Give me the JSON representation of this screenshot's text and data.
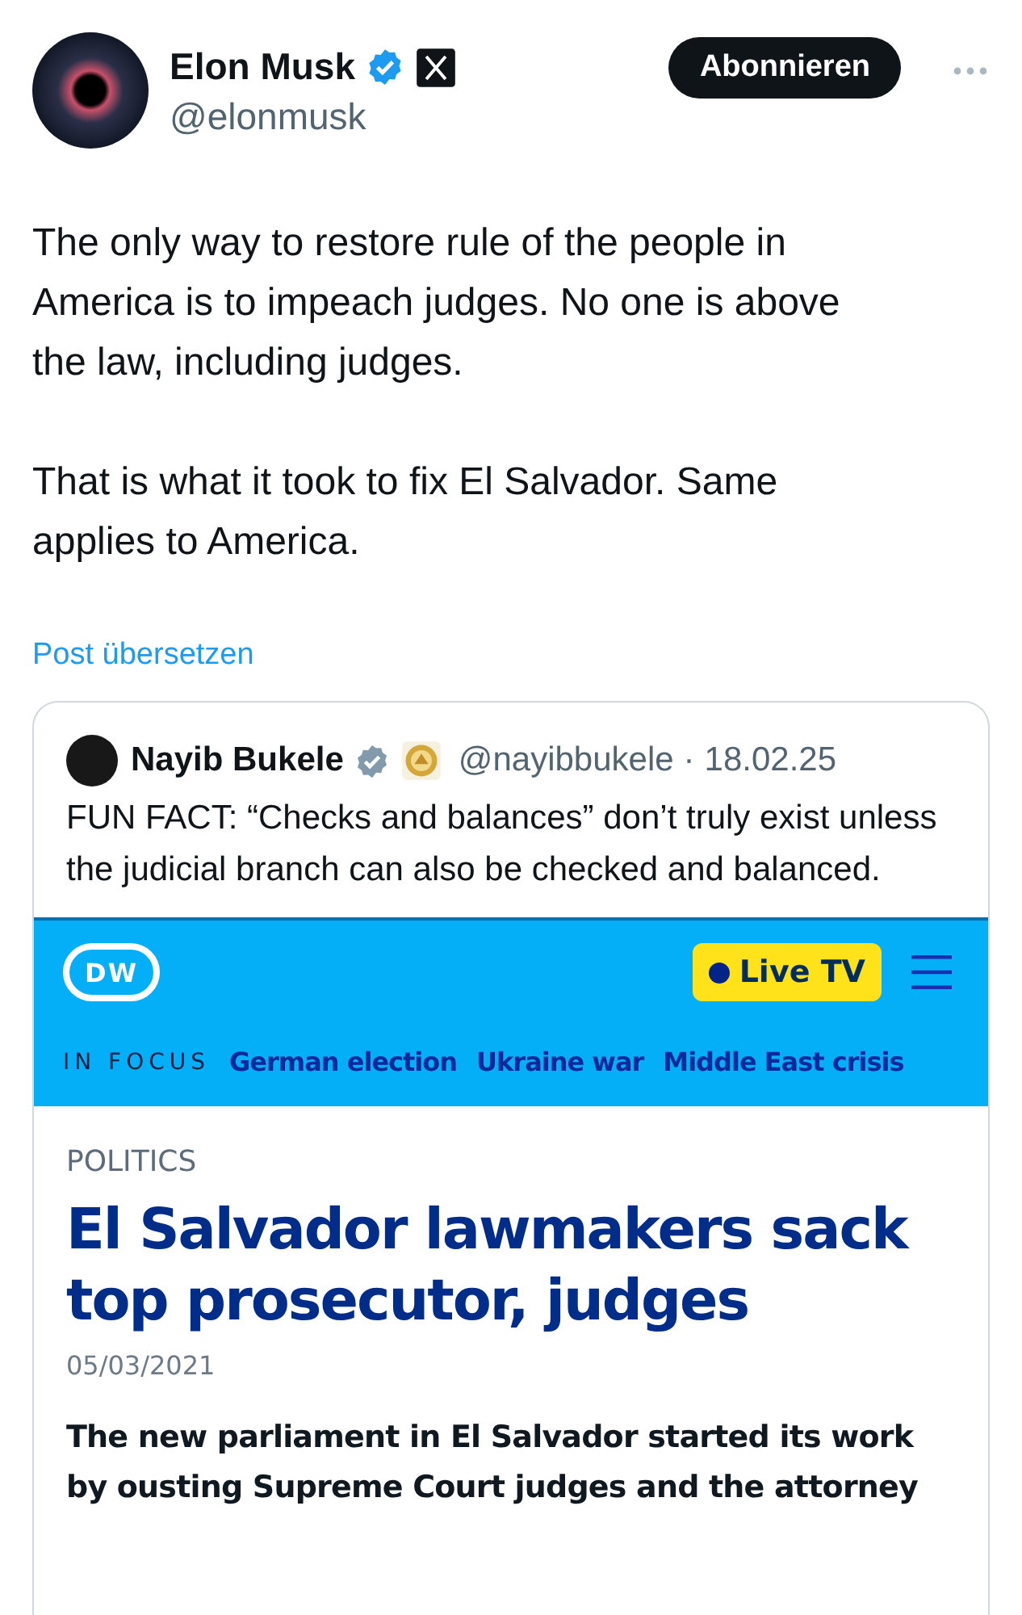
{
  "author": {
    "name": "Elon Musk",
    "handle": "@elonmusk",
    "verified": true,
    "affiliate_badge": true
  },
  "follow_button": "Abonnieren",
  "text": [
    "The only way to restore rule of the people in America is to impeach judges. No one is above the law, including judges.",
    "That is what it took to fix El Salvador. Same applies to America."
  ],
  "translate_link": "Post übersetzen",
  "quote": {
    "author": {
      "name": "Nayib Bukele",
      "verified": true,
      "affiliate_badge": true,
      "handle": "@nayibbukele",
      "separator": "·",
      "date": "18.02.25"
    },
    "text": "FUN FACT: “Checks and balances” don’t truly exist unless the judicial branch can also be checked and balanced.",
    "article": {
      "logo": "DW",
      "live_button": "Live TV",
      "focus_label": "IN FOCUS",
      "topics": [
        "German election",
        "Ukraine war",
        "Middle East crisis"
      ],
      "category": "POLITICS",
      "headline": "El Salvador lawmakers sack top prosecutor, judges",
      "date": "05/03/2021",
      "summary": "The new parliament in El Salvador started its work by ousting Supreme Court judges and the attorney"
    }
  }
}
